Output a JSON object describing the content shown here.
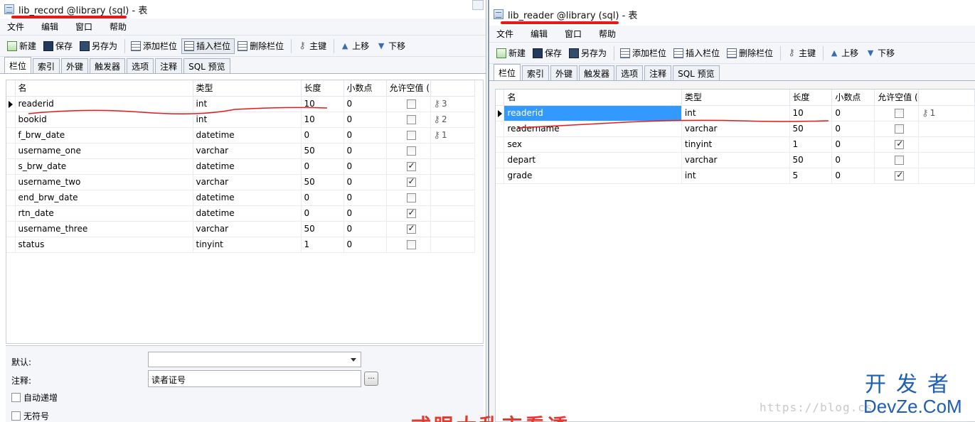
{
  "left_window": {
    "title": "lib_record @library (sql) - 表",
    "menu": [
      "文件",
      "编辑",
      "窗口",
      "帮助"
    ],
    "toolbar": [
      "新建",
      "保存",
      "另存为",
      "添加栏位",
      "插入栏位",
      "删除栏位",
      "主键",
      "上移",
      "下移"
    ],
    "tabs": [
      "栏位",
      "索引",
      "外键",
      "触发器",
      "选项",
      "注释",
      "SQL 预览"
    ],
    "columns": [
      "名",
      "类型",
      "长度",
      "小数点",
      "允许空值 (",
      ""
    ],
    "rows": [
      {
        "name": "readerid",
        "type": "int",
        "len": "10",
        "dec": "0",
        "nullable": false,
        "key": "3"
      },
      {
        "name": "bookid",
        "type": "int",
        "len": "10",
        "dec": "0",
        "nullable": false,
        "key": "2"
      },
      {
        "name": "f_brw_date",
        "type": "datetime",
        "len": "0",
        "dec": "0",
        "nullable": false,
        "key": "1"
      },
      {
        "name": "username_one",
        "type": "varchar",
        "len": "50",
        "dec": "0",
        "nullable": false,
        "key": ""
      },
      {
        "name": "s_brw_date",
        "type": "datetime",
        "len": "0",
        "dec": "0",
        "nullable": true,
        "key": ""
      },
      {
        "name": "username_two",
        "type": "varchar",
        "len": "50",
        "dec": "0",
        "nullable": true,
        "key": ""
      },
      {
        "name": "end_brw_date",
        "type": "datetime",
        "len": "0",
        "dec": "0",
        "nullable": false,
        "key": ""
      },
      {
        "name": "rtn_date",
        "type": "datetime",
        "len": "0",
        "dec": "0",
        "nullable": true,
        "key": ""
      },
      {
        "name": "username_three",
        "type": "varchar",
        "len": "50",
        "dec": "0",
        "nullable": true,
        "key": ""
      },
      {
        "name": "status",
        "type": "tinyint",
        "len": "1",
        "dec": "0",
        "nullable": false,
        "key": ""
      }
    ],
    "bottom": {
      "default_label": "默认:",
      "comment_label": "注释:",
      "comment_value": "读者证号",
      "dots_label": "...",
      "auto_inc_label": "自动递增",
      "unsigned_label": "无符号"
    }
  },
  "right_window": {
    "title": "lib_reader @library (sql) - 表",
    "menu": [
      "文件",
      "编辑",
      "窗口",
      "帮助"
    ],
    "toolbar": [
      "新建",
      "保存",
      "另存为",
      "添加栏位",
      "插入栏位",
      "删除栏位",
      "主键",
      "上移",
      "下移"
    ],
    "tabs": [
      "栏位",
      "索引",
      "外键",
      "触发器",
      "选项",
      "注释",
      "SQL 预览"
    ],
    "columns": [
      "名",
      "类型",
      "长度",
      "小数点",
      "允许空值 (",
      ""
    ],
    "rows": [
      {
        "name": "readerid",
        "type": "int",
        "len": "10",
        "dec": "0",
        "nullable": false,
        "key": "1"
      },
      {
        "name": "readername",
        "type": "varchar",
        "len": "50",
        "dec": "0",
        "nullable": false,
        "key": ""
      },
      {
        "name": "sex",
        "type": "tinyint",
        "len": "1",
        "dec": "0",
        "nullable": true,
        "key": ""
      },
      {
        "name": "depart",
        "type": "varchar",
        "len": "50",
        "dec": "0",
        "nullable": false,
        "key": ""
      },
      {
        "name": "grade",
        "type": "int",
        "len": "5",
        "dec": "0",
        "nullable": true,
        "key": ""
      }
    ]
  },
  "watermark": {
    "url": "https://blog.cs",
    "logo_cn": "开发者",
    "logo_en": "DevZe.CoM"
  },
  "bottom_caption": "一式眼大乱市看透",
  "colors": {
    "annotation_red": "#e31b1b",
    "selection_blue": "#3399ff",
    "logo_blue": "#1e5fb3"
  }
}
